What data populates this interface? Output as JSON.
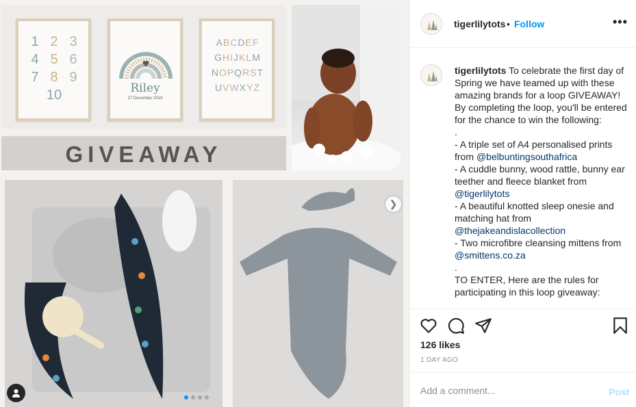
{
  "post": {
    "prints": {
      "numbers": [
        "1",
        "2",
        "3",
        "4",
        "5",
        "6",
        "7",
        "8",
        "9",
        "10"
      ],
      "letters": "ABCDEFGHIJKLMNOPQRSTUVWXYZ",
      "name": "Riley",
      "date": "27 December 2019"
    },
    "banner": "GIVEAWAY"
  },
  "header": {
    "username": "tigerlilytots",
    "separator": "•",
    "follow_label": "Follow",
    "more_label": "•••"
  },
  "caption": {
    "username": "tigerlilytots",
    "lines": [
      {
        "text": " To celebrate the first day of Spring we have teamed up with these amazing brands for a loop GIVEAWAY! By completing the loop, you'll be entered for the chance to win the following:\n.\n- A triple set of A4 personalised prints from ",
        "mention": "@belbuntingsouthafrica"
      },
      {
        "text": "\n- A cuddle bunny, wood rattle, bunny ear teether and fleece blanket from ",
        "mention": "@tigerlilytots"
      },
      {
        "text": "\n- A beautiful knotted sleep onesie and matching hat from ",
        "mention": "@thejakeandislacollection"
      },
      {
        "text": "\n- Two microfibre cleansing mittens from ",
        "mention": "@smittens.co.za"
      },
      {
        "text": "\n.\nTO ENTER, Here are the rules for participating in this loop giveaway:",
        "mention": ""
      }
    ]
  },
  "stats": {
    "likes": "126 likes",
    "time": "1 DAY AGO"
  },
  "comment_box": {
    "placeholder": "Add a comment...",
    "post_label": "Post"
  },
  "colors": {
    "link": "#0095f6",
    "mention": "#00376b",
    "muted": "#8e8e8e"
  }
}
